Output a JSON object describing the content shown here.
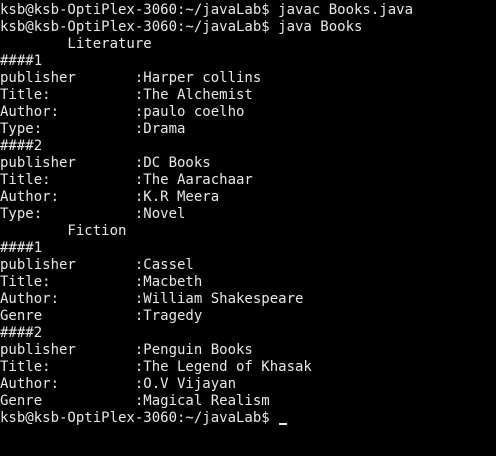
{
  "terminal": {
    "lines": [
      "ksb@ksb-OptiPlex-3060:~/javaLab$ javac Books.java",
      "ksb@ksb-OptiPlex-3060:~/javaLab$ java Books",
      "        Literature",
      "####1",
      "publisher       :Harper collins",
      "Title:          :The Alchemist",
      "Author:         :paulo coelho",
      "Type:           :Drama",
      "####2",
      "publisher       :DC Books",
      "Title:          :The Aarachaar",
      "Author:         :K.R Meera",
      "Type:           :Novel",
      "        Fiction",
      "####1",
      "publisher       :Cassel",
      "Title:          :Macbeth",
      "Author:         :William Shakespeare",
      "Genre           :Tragedy",
      "####2",
      "publisher       :Penguin Books",
      "Title:          :The Legend of Khasak",
      "Author:         :O.V Vijayan",
      "Genre           :Magical Realism"
    ],
    "prompt": "ksb@ksb-OptiPlex-3060:~/javaLab$ "
  },
  "colors": {
    "background": "#000000",
    "foreground": "#e8e8e8"
  }
}
